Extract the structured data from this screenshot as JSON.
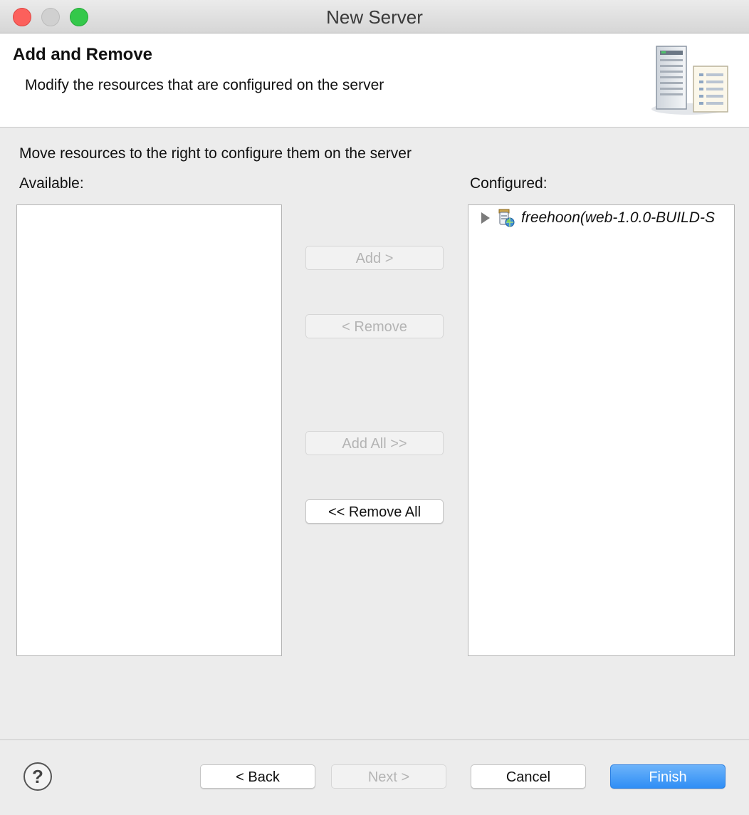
{
  "window": {
    "title": "New Server"
  },
  "banner": {
    "title": "Add and Remove",
    "description": "Modify the resources that are configured on the server",
    "illustration_icon": "server-wizard-icon"
  },
  "body": {
    "instructions": "Move resources to the right to configure them on the server",
    "available_label": "Available:",
    "configured_label": "Configured:",
    "available_items": [],
    "configured_items": [
      {
        "label": "freehoon(web-1.0.0-BUILD-S",
        "icon": "web-project-icon",
        "expanded": false
      }
    ]
  },
  "transfer_buttons": {
    "add": "Add >",
    "remove": "< Remove",
    "add_all": "Add All >>",
    "remove_all": "<< Remove All"
  },
  "footer": {
    "help": "?",
    "back": "< Back",
    "next": "Next >",
    "cancel": "Cancel",
    "finish": "Finish"
  },
  "colors": {
    "accent": "#2f8ef5",
    "close": "#fc605c",
    "maximize": "#34c84a",
    "minimize": "#d0d0d0"
  }
}
